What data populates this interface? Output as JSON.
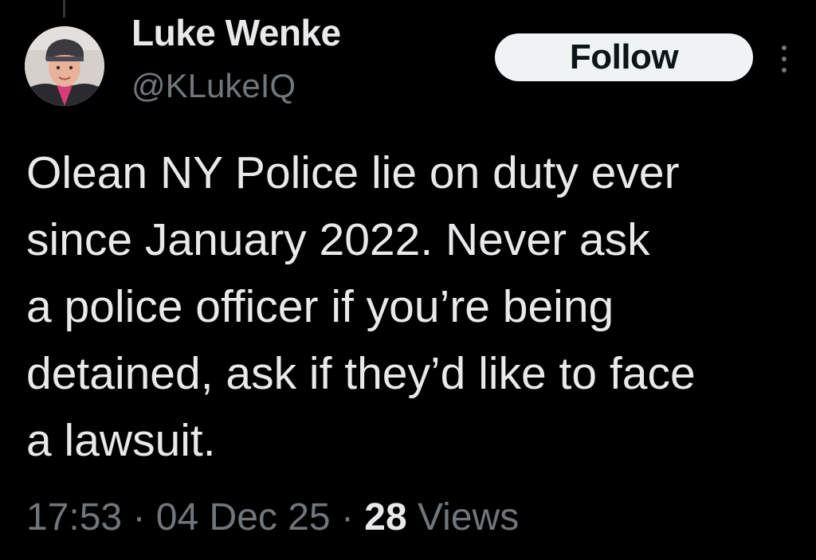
{
  "author": {
    "display_name": "Luke Wenke",
    "handle": "@KLukeIQ",
    "avatar_icon": "user-avatar"
  },
  "header": {
    "follow_label": "Follow",
    "more_icon": "more-vertical-icon"
  },
  "tweet": {
    "text": "Olean NY Police lie on duty ever\nsince January 2022.  Never ask\na police officer if you’re being\ndetained, ask if they’d like to face\na lawsuit."
  },
  "meta": {
    "time": "17:53",
    "separator": "·",
    "date": "04 Dec 25",
    "views_count": "28",
    "views_label": "Views"
  },
  "colors": {
    "background": "#000000",
    "primary_text": "#e7e9ea",
    "secondary_text": "#71767b",
    "follow_bg": "#eff3f4",
    "follow_text": "#0f1419"
  }
}
